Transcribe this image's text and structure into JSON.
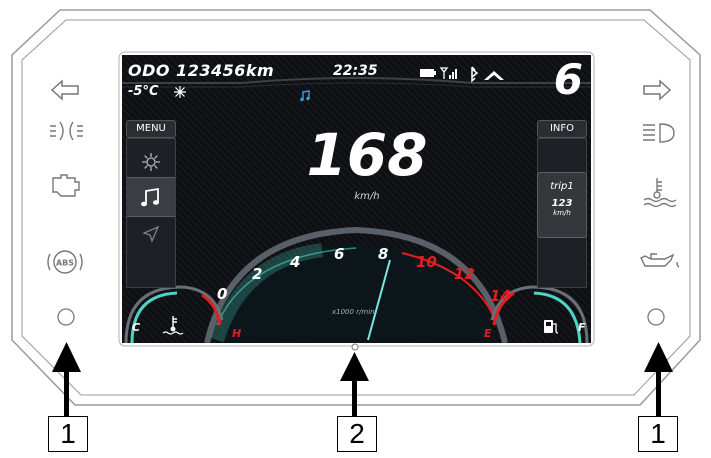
{
  "dashboard": {
    "odometer": "ODO 123456km",
    "clock": "22:35",
    "temperature": "-5°C",
    "snow_icon": "snowflake-icon",
    "gear": "6",
    "speed": "168",
    "speed_unit": "km/h",
    "menu_label": "MENU",
    "info_label": "INFO",
    "trip_label": "trip1",
    "trip_value": "123",
    "trip_unit": "km/h",
    "rpm_unit_label": "x1000 r/min",
    "rpm_ticks": [
      "0",
      "2",
      "4",
      "6",
      "8",
      "10",
      "12",
      "14"
    ],
    "coolant_cold": "C",
    "coolant_hot": "H",
    "fuel_empty": "E",
    "fuel_full": "F",
    "menu_icons": [
      "gear-icon",
      "music-note-icon",
      "navigation-arrow-icon"
    ],
    "status_icons": [
      "battery-icon",
      "signal-icon",
      "bluetooth-icon",
      "gear-up-indicator-icon"
    ]
  },
  "left_indicators": [
    "left-turn-icon",
    "position-light-icon",
    "engine-check-icon",
    "abs-icon"
  ],
  "right_indicators": [
    "right-turn-icon",
    "high-beam-icon",
    "coolant-temperature-icon",
    "oil-pressure-icon"
  ],
  "callouts": {
    "left": "1",
    "center": "2",
    "right": "1"
  },
  "colors": {
    "accent_teal": "#4fd3c4",
    "redline": "#e02020",
    "music_blue": "#3aa0e6"
  }
}
